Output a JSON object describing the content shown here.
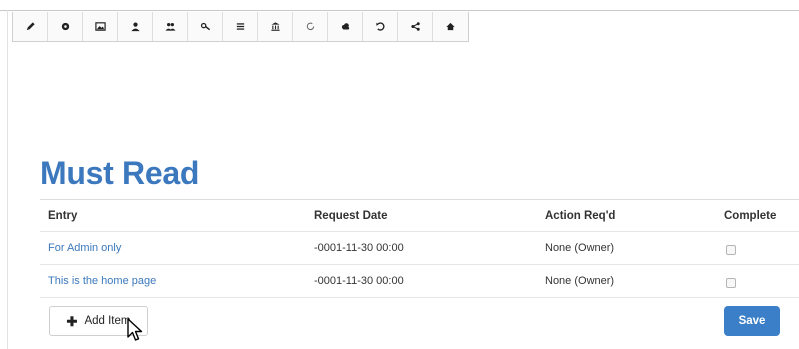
{
  "toolbar": {
    "tools": [
      {
        "icon": "pencil-icon"
      },
      {
        "icon": "gear-icon"
      },
      {
        "icon": "image-icon"
      },
      {
        "icon": "user-icon"
      },
      {
        "icon": "users-icon"
      },
      {
        "icon": "key-icon"
      },
      {
        "icon": "list-icon"
      },
      {
        "icon": "bank-icon"
      },
      {
        "icon": "refresh-icon"
      },
      {
        "icon": "cloud-icon"
      },
      {
        "icon": "undo-icon"
      },
      {
        "icon": "share-icon"
      },
      {
        "icon": "home-icon"
      }
    ]
  },
  "section": {
    "title": "Must Read"
  },
  "table": {
    "headers": {
      "entry": "Entry",
      "request_date": "Request Date",
      "action": "Action Req'd",
      "complete": "Complete"
    },
    "rows": [
      {
        "entry": "For Admin only",
        "request_date": "-0001-11-30 00:00",
        "action": "None (Owner)",
        "complete": false
      },
      {
        "entry": "This is the home page",
        "request_date": "-0001-11-30 00:00",
        "action": "None (Owner)",
        "complete": false
      }
    ]
  },
  "actions": {
    "add_item_label": "Add Item",
    "save_label": "Save"
  },
  "colors": {
    "accent": "#3b78bd",
    "save_button": "#3a7fc7"
  }
}
